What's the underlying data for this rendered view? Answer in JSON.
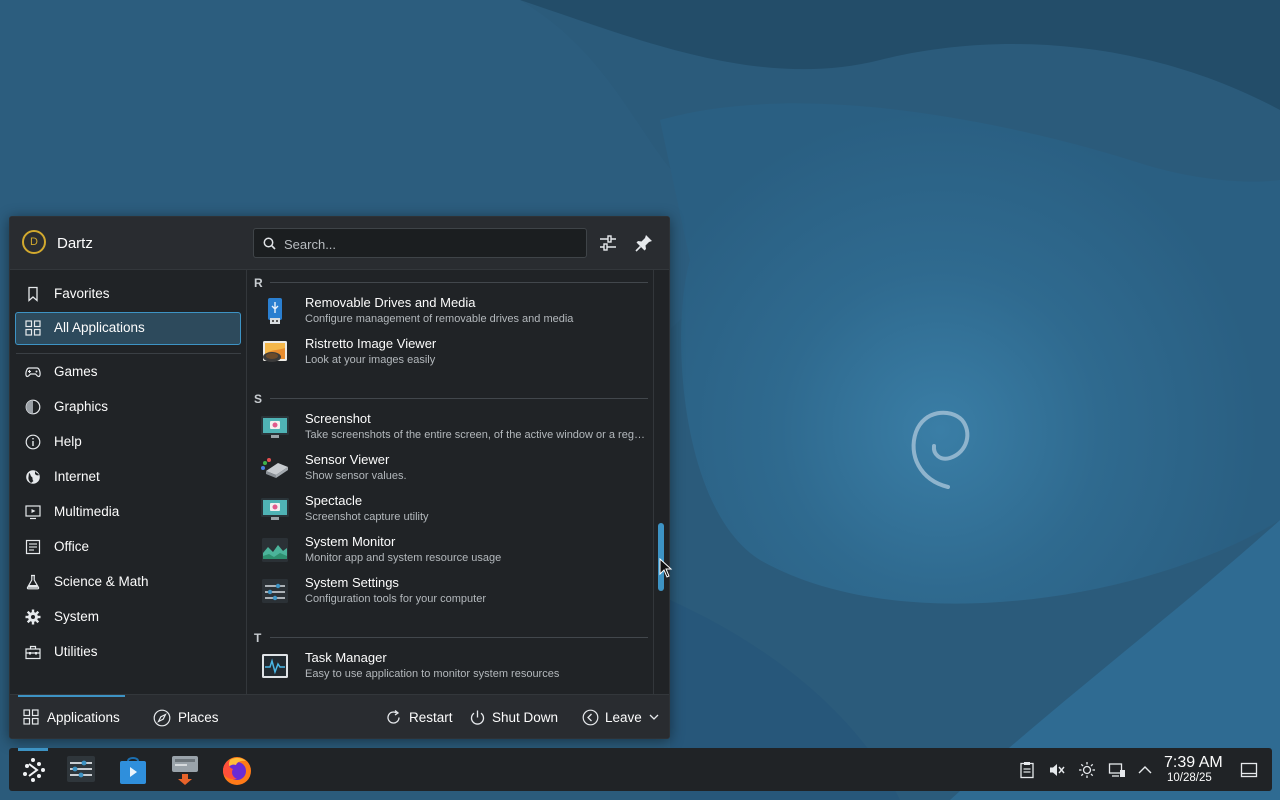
{
  "launcher": {
    "user_initial": "D",
    "user_name": "Dartz",
    "search_placeholder": "Search...",
    "sidebar": [
      {
        "label": "Favorites",
        "icon": "bookmark-icon"
      },
      {
        "label": "All Applications",
        "icon": "grid-icon",
        "selected": true
      },
      {
        "label": "Games",
        "icon": "gamepad-icon"
      },
      {
        "label": "Graphics",
        "icon": "graphics-icon"
      },
      {
        "label": "Help",
        "icon": "info-icon"
      },
      {
        "label": "Internet",
        "icon": "globe-icon"
      },
      {
        "label": "Multimedia",
        "icon": "multimedia-icon"
      },
      {
        "label": "Office",
        "icon": "office-icon"
      },
      {
        "label": "Science & Math",
        "icon": "flask-icon"
      },
      {
        "label": "System",
        "icon": "gear-icon"
      },
      {
        "label": "Utilities",
        "icon": "toolbox-icon"
      }
    ],
    "sections": {
      "r": "R",
      "s": "S",
      "t": "T"
    },
    "apps": [
      {
        "name": "Removable Drives and Media",
        "desc": "Configure management of removable drives and media",
        "icon": "usb-drive-icon"
      },
      {
        "name": "Ristretto Image Viewer",
        "desc": "Look at your images easily",
        "icon": "image-viewer-icon"
      },
      {
        "name": "Screenshot",
        "desc": "Take screenshots of the entire screen, of the active window or a region",
        "icon": "screenshot-icon"
      },
      {
        "name": "Sensor Viewer",
        "desc": "Show sensor values.",
        "icon": "sensor-icon"
      },
      {
        "name": "Spectacle",
        "desc": "Screenshot capture utility",
        "icon": "spectacle-icon"
      },
      {
        "name": "System Monitor",
        "desc": "Monitor app and system resource usage",
        "icon": "system-monitor-icon"
      },
      {
        "name": "System Settings",
        "desc": "Configuration tools for your computer",
        "icon": "system-settings-icon"
      },
      {
        "name": "Task Manager",
        "desc": "Easy to use application to monitor system resources",
        "icon": "task-manager-icon"
      }
    ],
    "footer": {
      "applications": "Applications",
      "places": "Places",
      "restart": "Restart",
      "shutdown": "Shut Down",
      "leave": "Leave"
    }
  },
  "taskbar": {
    "apps": [
      "application-launcher",
      "system-settings",
      "discover",
      "disk-manager",
      "firefox"
    ],
    "clock_time": "7:39 AM",
    "clock_date": "10/28/25"
  },
  "colors": {
    "accent": "#3d93c4",
    "panel": "#202326",
    "desktop": "#2a5a78"
  }
}
